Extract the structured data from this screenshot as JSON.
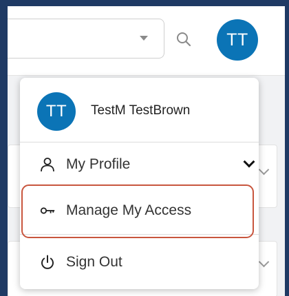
{
  "header": {
    "avatar_initials": "TT"
  },
  "user_menu": {
    "avatar_initials": "TT",
    "user_name": "TestM TestBrown",
    "items": [
      {
        "label": "My Profile",
        "icon": "person-icon",
        "expandable": true
      },
      {
        "label": "Manage My Access",
        "icon": "key-icon",
        "highlighted": true
      },
      {
        "label": "Sign Out",
        "icon": "power-icon"
      }
    ]
  },
  "colors": {
    "avatar": "#0b74b6",
    "highlight": "#c8553d",
    "frame": "#1f3a64"
  }
}
